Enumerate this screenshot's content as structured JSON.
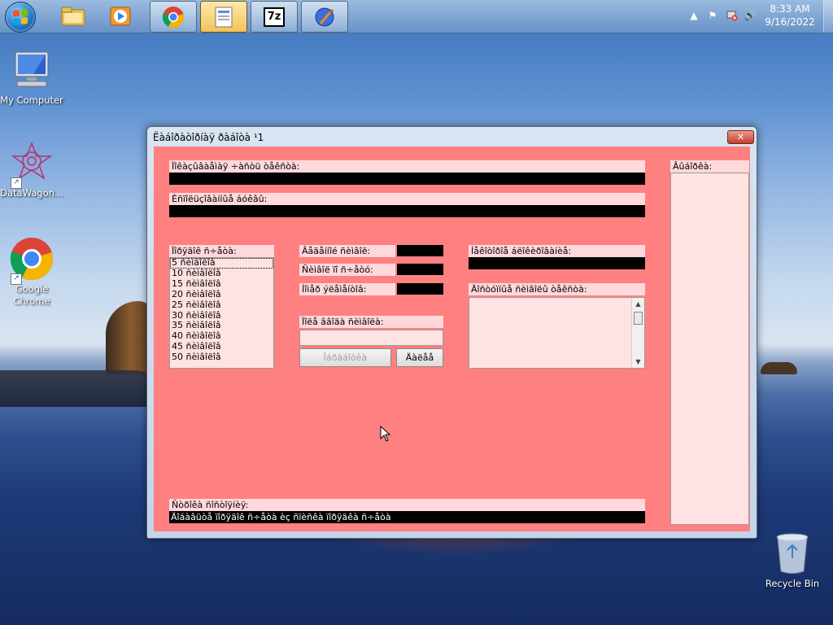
{
  "taskbar": {
    "start_icon": "windows-orb-icon",
    "pinned": [
      {
        "name": "file-explorer",
        "icon": "folder-icon"
      },
      {
        "name": "media-player",
        "icon": "media-player-icon"
      },
      {
        "name": "chrome",
        "icon": "chrome-icon"
      },
      {
        "name": "app-window",
        "icon": "app-icon"
      },
      {
        "name": "7zip",
        "icon": "7zip-icon",
        "label": "7z"
      },
      {
        "name": "app-2",
        "icon": "pen-app-icon"
      }
    ],
    "clock": {
      "time": "8:33 AM",
      "date": "9/16/2022"
    }
  },
  "desktop": {
    "icons": [
      {
        "label": "My Computer",
        "icon": "computer-icon"
      },
      {
        "label": "DataWagon...",
        "icon": "datawagon-icon"
      },
      {
        "label": "Google Chrome",
        "icon": "chrome-icon"
      },
      {
        "label": "Recycle Bin",
        "icon": "recycle-bin-icon"
      }
    ]
  },
  "window": {
    "title": "Ëàáîðàòîðíàÿ ðàáîòà ¹1",
    "close_label": "✕",
    "client_bg": "#ff8080",
    "label_bg": "#ffd8dc",
    "fields": {
      "counter_label": "Ïîêàçûâàåìàÿ ÷àñòü òåêñòà:",
      "result_label": "Èñïîëüçîâàííûå áóêâû:",
      "interval_label": "Ïîðÿäîê ñ÷åòà:",
      "length_label": "Âåäåííîé ñèìâîë:",
      "chars_label": "Ñèìâîë ïî ñ÷åòó:",
      "sym_count_label": "Íîìåð ýëåìåíòîâ:",
      "frequency_label": "Íåêîòîðîå áëîêèðîâàíèå:",
      "new_text_label": "Ïîëå ââîäà ñèìâîëà:",
      "stats_label": "Äîñòóïíûå ñèìâîëû òåêñòà:",
      "sidebar_label": "Âûáîðêà:",
      "status_label": "Ñòðîêà ñîñòîÿíèÿ:"
    },
    "interval_list": [
      "5 ñèìâîëîâ",
      "10 ñèìâîëîâ",
      "15 ñèìâîëîâ",
      "20 ñèìâîëîâ",
      "25 ñèìâîëîâ",
      "30 ñèìâîëîâ",
      "35 ñèìâîëîâ",
      "40 ñèìâîëîâ",
      "45 ñèìâîëîâ",
      "50 ñèìâîëîâ"
    ],
    "buttons": {
      "confirm": "Îáðàáîòêà",
      "delete": "Äàëåå"
    },
    "status_text": "Äîáàâüòå ïîðÿäîê ñ÷åòà èç ñïèñêà ïîðÿäêà ñ÷åòà"
  }
}
